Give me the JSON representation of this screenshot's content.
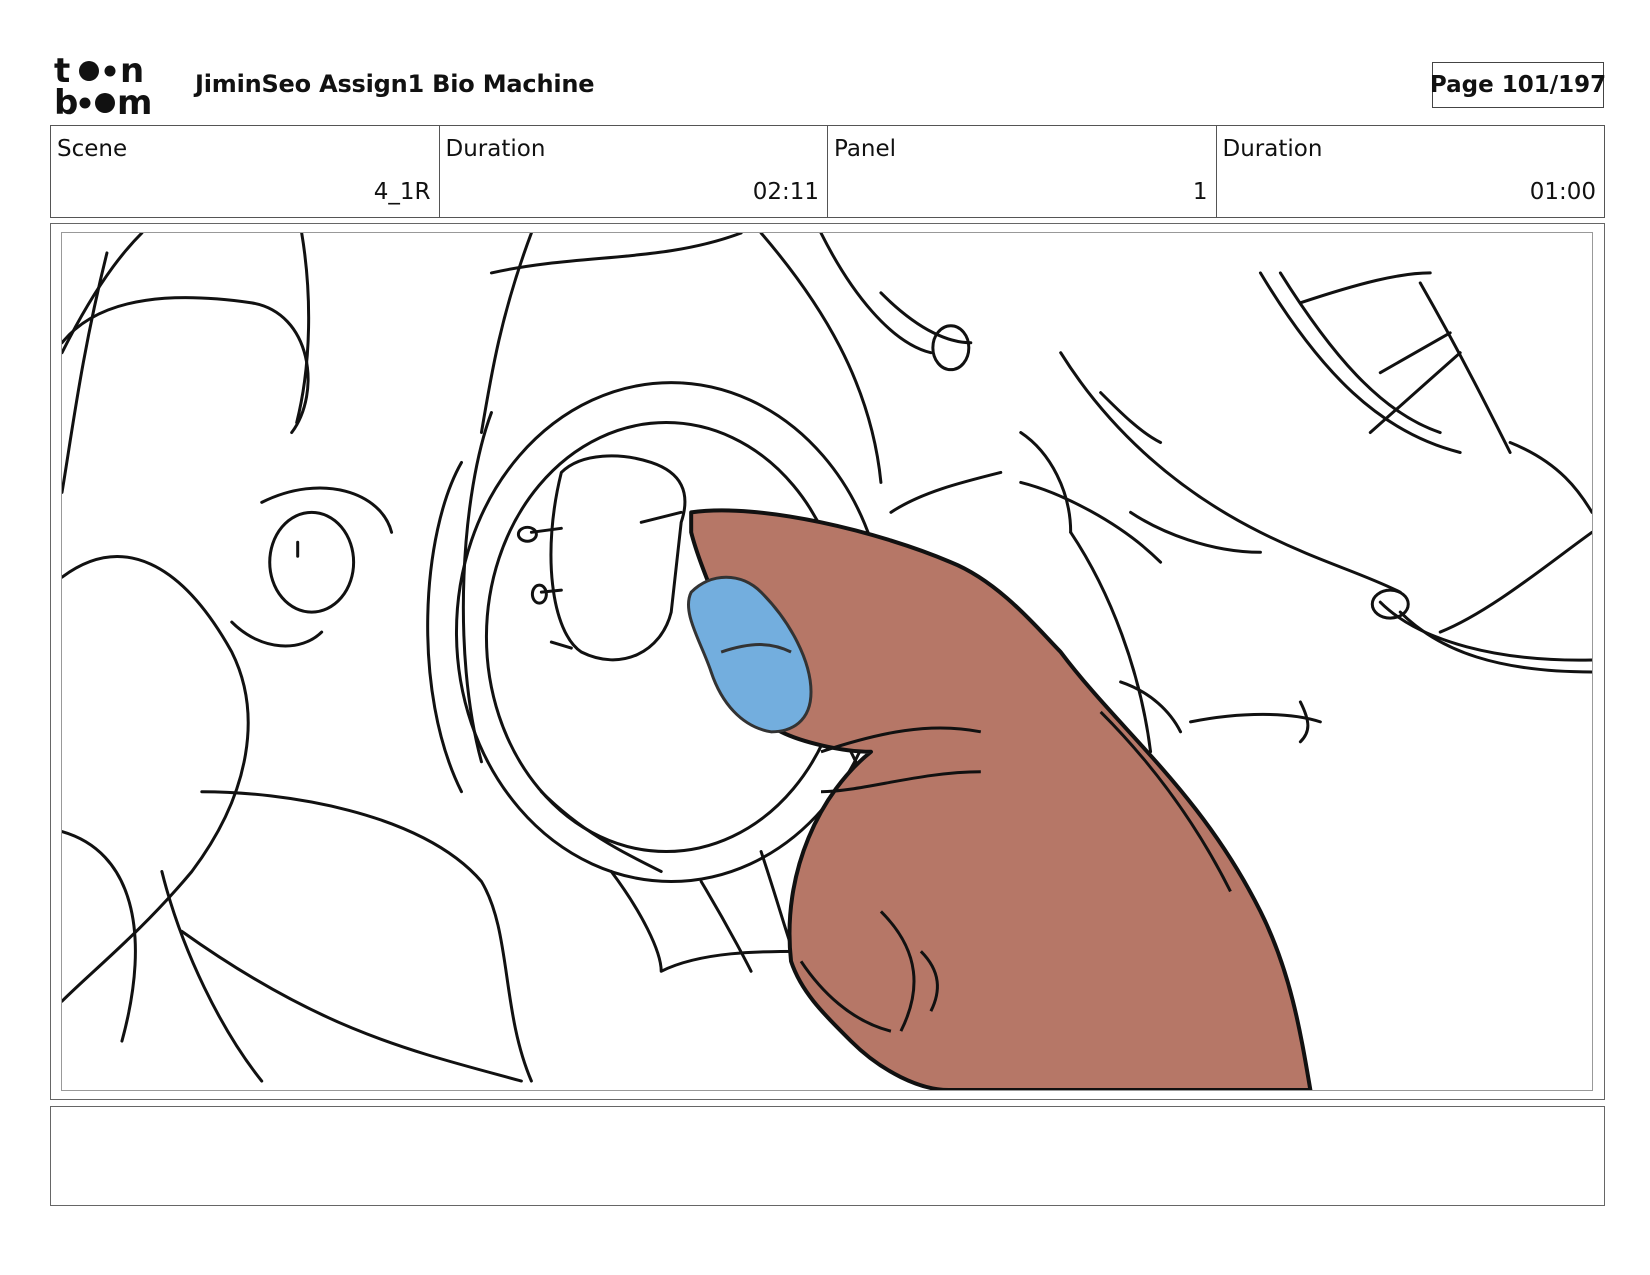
{
  "header": {
    "logo_icon": "toonboom-logo",
    "logo_text": "toon boom",
    "title": "JiminSeo Assign1 Bio Machine",
    "page": "Page 101/197"
  },
  "info": {
    "scene_label": "Scene",
    "scene_value": "4_1R",
    "scene_duration_label": "Duration",
    "scene_duration_value": "02:11",
    "panel_label": "Panel",
    "panel_value": "1",
    "panel_duration_label": "Duration",
    "panel_duration_value": "01:00"
  },
  "panel_image": {
    "description_icon": "storyboard-sketch",
    "colors": {
      "hand": "#b67767",
      "fingernail": "#73aede",
      "ink": "#111111"
    }
  },
  "notes": {
    "text": ""
  }
}
